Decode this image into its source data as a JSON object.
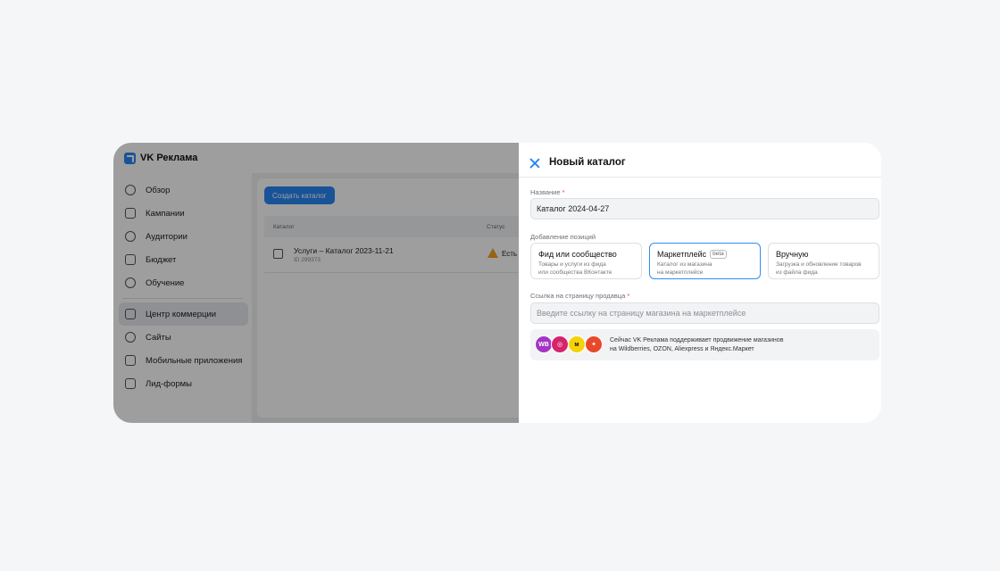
{
  "app": {
    "logo_text": "VK Реклама",
    "sidebar": {
      "items": [
        {
          "label": "Обзор",
          "icon": "compass-icon"
        },
        {
          "label": "Кампании",
          "icon": "megaphone-icon"
        },
        {
          "label": "Аудитории",
          "icon": "users-icon"
        },
        {
          "label": "Бюджет",
          "icon": "wallet-icon"
        },
        {
          "label": "Обучение",
          "icon": "question-icon"
        }
      ],
      "items2": [
        {
          "label": "Центр коммерции",
          "icon": "cart-icon",
          "active": true
        },
        {
          "label": "Сайты",
          "icon": "globe-icon"
        },
        {
          "label": "Мобильные приложения",
          "icon": "phone-icon"
        },
        {
          "label": "Лид-формы",
          "icon": "form-icon"
        }
      ]
    },
    "content": {
      "create_button": "Создать каталог",
      "table": {
        "columns": [
          "Каталог",
          "Статус"
        ],
        "rows": [
          {
            "title": "Услуги – Каталог 2023-11-21",
            "id": "ID 299373",
            "status": "Есть"
          }
        ]
      }
    }
  },
  "panel": {
    "title": "Новый каталог",
    "name_label": "Название",
    "required_mark": "*",
    "name_value": "Каталог 2024-04-27",
    "positions_label": "Добавление позиций",
    "options": [
      {
        "title": "Фид или сообщество",
        "desc1": "Товары и услуги из фида",
        "desc2": "или сообщества ВКонтакте",
        "badge": ""
      },
      {
        "title": "Маркетплейс",
        "desc1": "Каталог из магазина",
        "desc2": "на маркетплейсе",
        "badge": "beta",
        "selected": true
      },
      {
        "title": "Вручную",
        "desc1": "Загрузка и обновление товаров",
        "desc2": "из файла фида",
        "badge": ""
      }
    ],
    "seller_link_label": "Ссылка на страницу продавца",
    "seller_link_placeholder": "Введите ссылку на страницу магазина на маркетплейсе",
    "info_line1": "Сейчас VK Реклама поддерживает продвижение магазинов",
    "info_line2": "на Wildberries, OZON, Aliexpress и Яндекс.Маркет",
    "marketplace_logos": [
      {
        "name": "wildberries-logo",
        "text": "WB",
        "color": "#a335c3"
      },
      {
        "name": "ozon-logo",
        "text": "",
        "color": "#d6246b"
      },
      {
        "name": "yandex-market-logo",
        "text": "",
        "color": "#f7d10a"
      },
      {
        "name": "aliexpress-logo",
        "text": "",
        "color": "#e8492b"
      }
    ]
  },
  "colors": {
    "accent": "#2787f5",
    "warning": "#f2a11b"
  }
}
